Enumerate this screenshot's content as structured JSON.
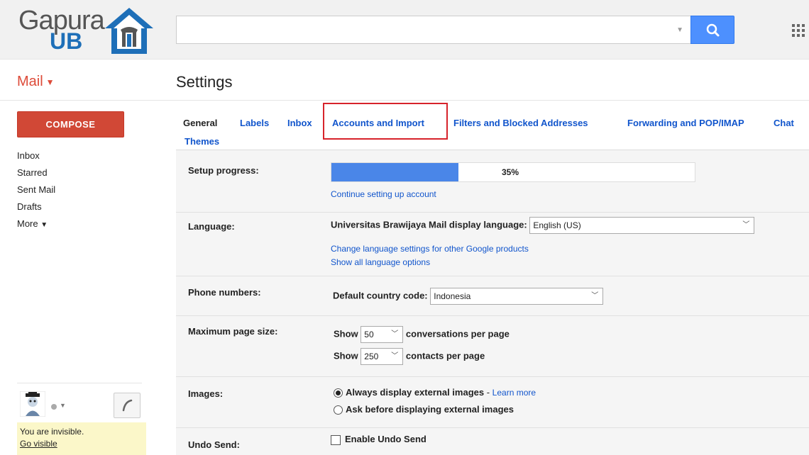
{
  "header": {
    "logo_line1": "Gapura",
    "logo_line2": "UB",
    "search_placeholder": ""
  },
  "nav": {
    "mail_label": "Mail",
    "page_title": "Settings"
  },
  "sidebar": {
    "compose_label": "COMPOSE",
    "items": [
      {
        "label": "Inbox"
      },
      {
        "label": "Starred"
      },
      {
        "label": "Sent Mail"
      },
      {
        "label": "Drafts"
      },
      {
        "label": "More"
      }
    ],
    "chat_status": "You are invisible.",
    "go_visible": "Go visible"
  },
  "tabs": [
    {
      "label": "General",
      "active": true
    },
    {
      "label": "Labels"
    },
    {
      "label": "Inbox"
    },
    {
      "label": "Accounts and Import",
      "highlighted": true
    },
    {
      "label": "Filters and Blocked Addresses"
    },
    {
      "label": "Forwarding and POP/IMAP"
    },
    {
      "label": "Chat"
    },
    {
      "label": "Themes"
    }
  ],
  "settings": {
    "setup": {
      "label": "Setup progress:",
      "progress_percent": 35,
      "progress_text": "35%",
      "link": "Continue setting up account"
    },
    "language": {
      "label": "Language:",
      "prompt": "Universitas Brawijaya Mail display language:",
      "value": "English (US)",
      "link1": "Change language settings for other Google products",
      "link2": "Show all language options"
    },
    "phone": {
      "label": "Phone numbers:",
      "prompt": "Default country code:",
      "value": "Indonesia"
    },
    "page_size": {
      "label": "Maximum page size:",
      "show": "Show",
      "conv_value": "50",
      "conv_text": "conversations per page",
      "contacts_value": "250",
      "contacts_text": "contacts per page"
    },
    "images": {
      "label": "Images:",
      "opt1": "Always display external images",
      "opt1_sep": " - ",
      "learn_more": "Learn more",
      "opt2": "Ask before displaying external images"
    },
    "undo": {
      "label": "Undo Send:",
      "checkbox_label": "Enable Undo Send"
    }
  },
  "colors": {
    "accent_red": "#dd4b39",
    "compose_red": "#d14836",
    "link_blue": "#1155cc",
    "search_blue": "#4d90fe",
    "highlight_red": "#d7232b",
    "progress_blue": "#4a86e8"
  }
}
